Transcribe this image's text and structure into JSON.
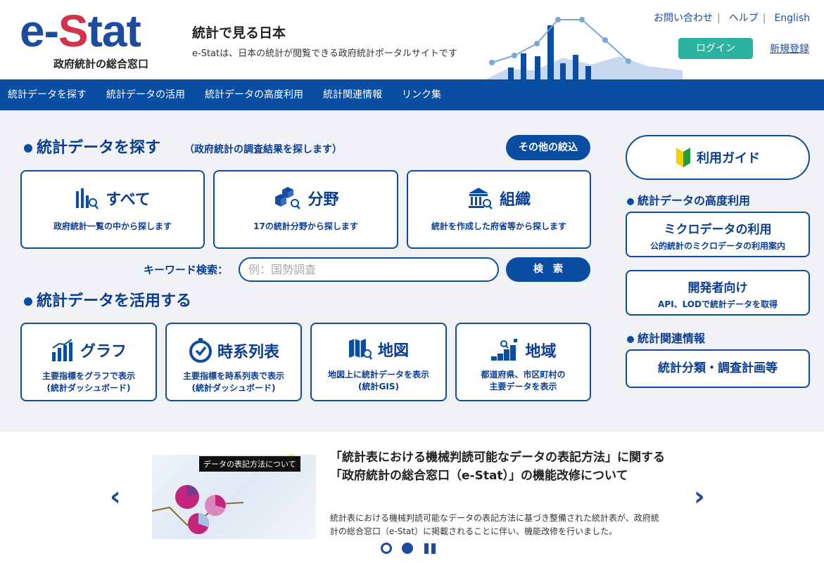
{
  "header": {
    "logo_text_e": "e-",
    "logo_text_s": "S",
    "logo_text_tat": "tat",
    "logo_sub": "政府統計の総合窓口",
    "tagline_title": "統計で見る日本",
    "tagline_sub": "e-Statは、日本の統計が閲覧できる政府統計ポータルサイトです",
    "links": [
      "お問い合わせ",
      "ヘルプ",
      "English"
    ],
    "login": "ログイン",
    "register": "新規登録"
  },
  "nav": [
    "統計データを探す",
    "統計データの活用",
    "統計データの高度利用",
    "統計関連情報",
    "リンク集"
  ],
  "search_section": {
    "title": "統計データを探す",
    "subtitle": "（政府統計の調査結果を探します）",
    "filter_button": "その他の絞込",
    "cards": [
      {
        "title": "すべて",
        "desc": "政府統計一覧の中から探します",
        "icon": "bar-chart-search-icon"
      },
      {
        "title": "分野",
        "desc": "17の統計分野から探します",
        "icon": "cubes-search-icon"
      },
      {
        "title": "組織",
        "desc": "統計を作成した府省等から探します",
        "icon": "building-search-icon"
      }
    ],
    "keyword_label": "キーワード検索：",
    "keyword_placeholder": "例：国勢調査",
    "search_button": "検　索"
  },
  "use_section": {
    "title": "統計データを活用する",
    "cards": [
      {
        "title": "グラフ",
        "desc1": "主要指標をグラフで表示",
        "desc2": "(統計ダッシュボード)",
        "icon": "graph-icon"
      },
      {
        "title": "時系列表",
        "desc1": "主要指標を時系列表で表示",
        "desc2": "(統計ダッシュボード)",
        "icon": "timer-icon"
      },
      {
        "title": "地図",
        "desc1": "地図上に統計データを表示",
        "desc2": "(統計GIS)",
        "icon": "map-search-icon"
      },
      {
        "title": "地域",
        "desc1": "都道府県、市区町村の",
        "desc2": "主要データを表示",
        "icon": "region-icon"
      }
    ]
  },
  "sidebar": {
    "guide": "利用ガイド",
    "advanced_head": "統計データの高度利用",
    "micro_title": "ミクロデータの利用",
    "micro_desc": "公的統計のミクロデータの利用案内",
    "dev_title": "開発者向け",
    "dev_desc": "API、LODで統計データを取得",
    "related_head": "統計関連情報",
    "classification": "統計分類・調査計画等"
  },
  "carousel": {
    "banner_tag": "データの表記方法について",
    "news_title": "「統計表における機械判読可能なデータの表記方法」に関する「政府統計の総合窓口（e-Stat）」の機能改修について",
    "news_body": "統計表における機械判読可能なデータの表記方法に基づき整備された統計表が、政府統計の総合窓口（e-Stat）に掲載されることに伴い、機能改修を行いました。"
  }
}
